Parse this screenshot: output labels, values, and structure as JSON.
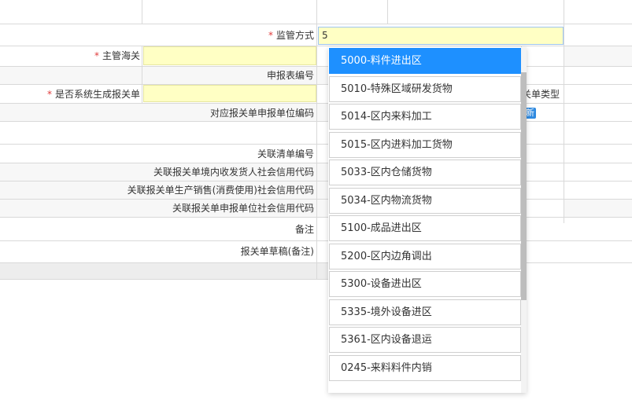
{
  "form": {
    "supervision_mode": {
      "required_mark": "*",
      "label": "监管方式",
      "value": "5"
    },
    "customs": {
      "required_mark": "*",
      "label": "主管海关"
    },
    "declaration_form_no": {
      "label": "申报表编号"
    },
    "auto_generate_declaration": {
      "required_mark": "*",
      "label": "是否系统生成报关单"
    },
    "declaration_unit_code": {
      "label": "对应报关单申报单位编码"
    },
    "declaration_type_partial": "关单类型",
    "new_badge": "新",
    "linked_list_no": {
      "label": "关联清单编号"
    },
    "consignee_credit_code": {
      "label": "关联报关单境内收发货人社会信用代码"
    },
    "producer_credit_code": {
      "label": "关联报关单生产销售(消费使用)社会信用代码"
    },
    "declarant_credit_code": {
      "label": "关联报关单申报单位社会信用代码"
    },
    "remarks": {
      "label": "备注"
    },
    "draft_remarks": {
      "label": "报关单草稿(备注)"
    }
  },
  "dropdown": {
    "options": [
      "5000-料件进出区",
      "5010-特殊区域研发货物",
      "5014-区内来料加工",
      "5015-区内进料加工货物",
      "5033-区内仓储货物",
      "5034-区内物流货物",
      "5100-成品进出区",
      "5200-区内边角调出",
      "5300-设备进出区",
      "5335-境外设备进区",
      "5361-区内设备退运",
      "0245-来料料件内销"
    ],
    "selected_index": 0
  },
  "colors": {
    "required": "#e03c3c",
    "input_highlight": "#ffffc4",
    "selected_option": "#1e90ff"
  }
}
